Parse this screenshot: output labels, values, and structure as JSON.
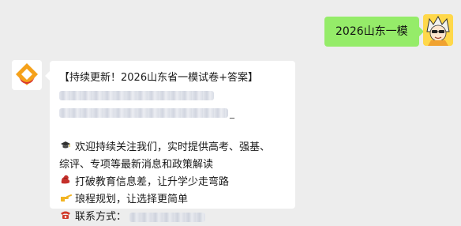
{
  "outgoing": {
    "text": "2026山东一模"
  },
  "incoming": {
    "title": "【持续更新！2026山东省一模试卷+答案】",
    "underscore": "_",
    "follow_line1": "欢迎持续关注我们，实时提供高考、强基、",
    "follow_line2": "综评、专项等最新消息和政策解读",
    "line_break_info": "打破教育信息差，让升学少走弯路",
    "line_plan": "琅程规划，让选择更简单",
    "contact_label": "联系方式："
  },
  "icons": {
    "user_avatar": "cartoon-avatar-icon",
    "bot_avatar": "brand-logo-icon",
    "grad_cap": "graduation-cap-icon",
    "muscle": "muscle-icon",
    "pointing": "pointing-hand-icon",
    "phone": "phone-icon"
  },
  "colors": {
    "outgoing_bubble": "#95ec69",
    "background": "#ededed",
    "logo_orange": "#f5a11a",
    "logo_red": "#d9382f"
  }
}
